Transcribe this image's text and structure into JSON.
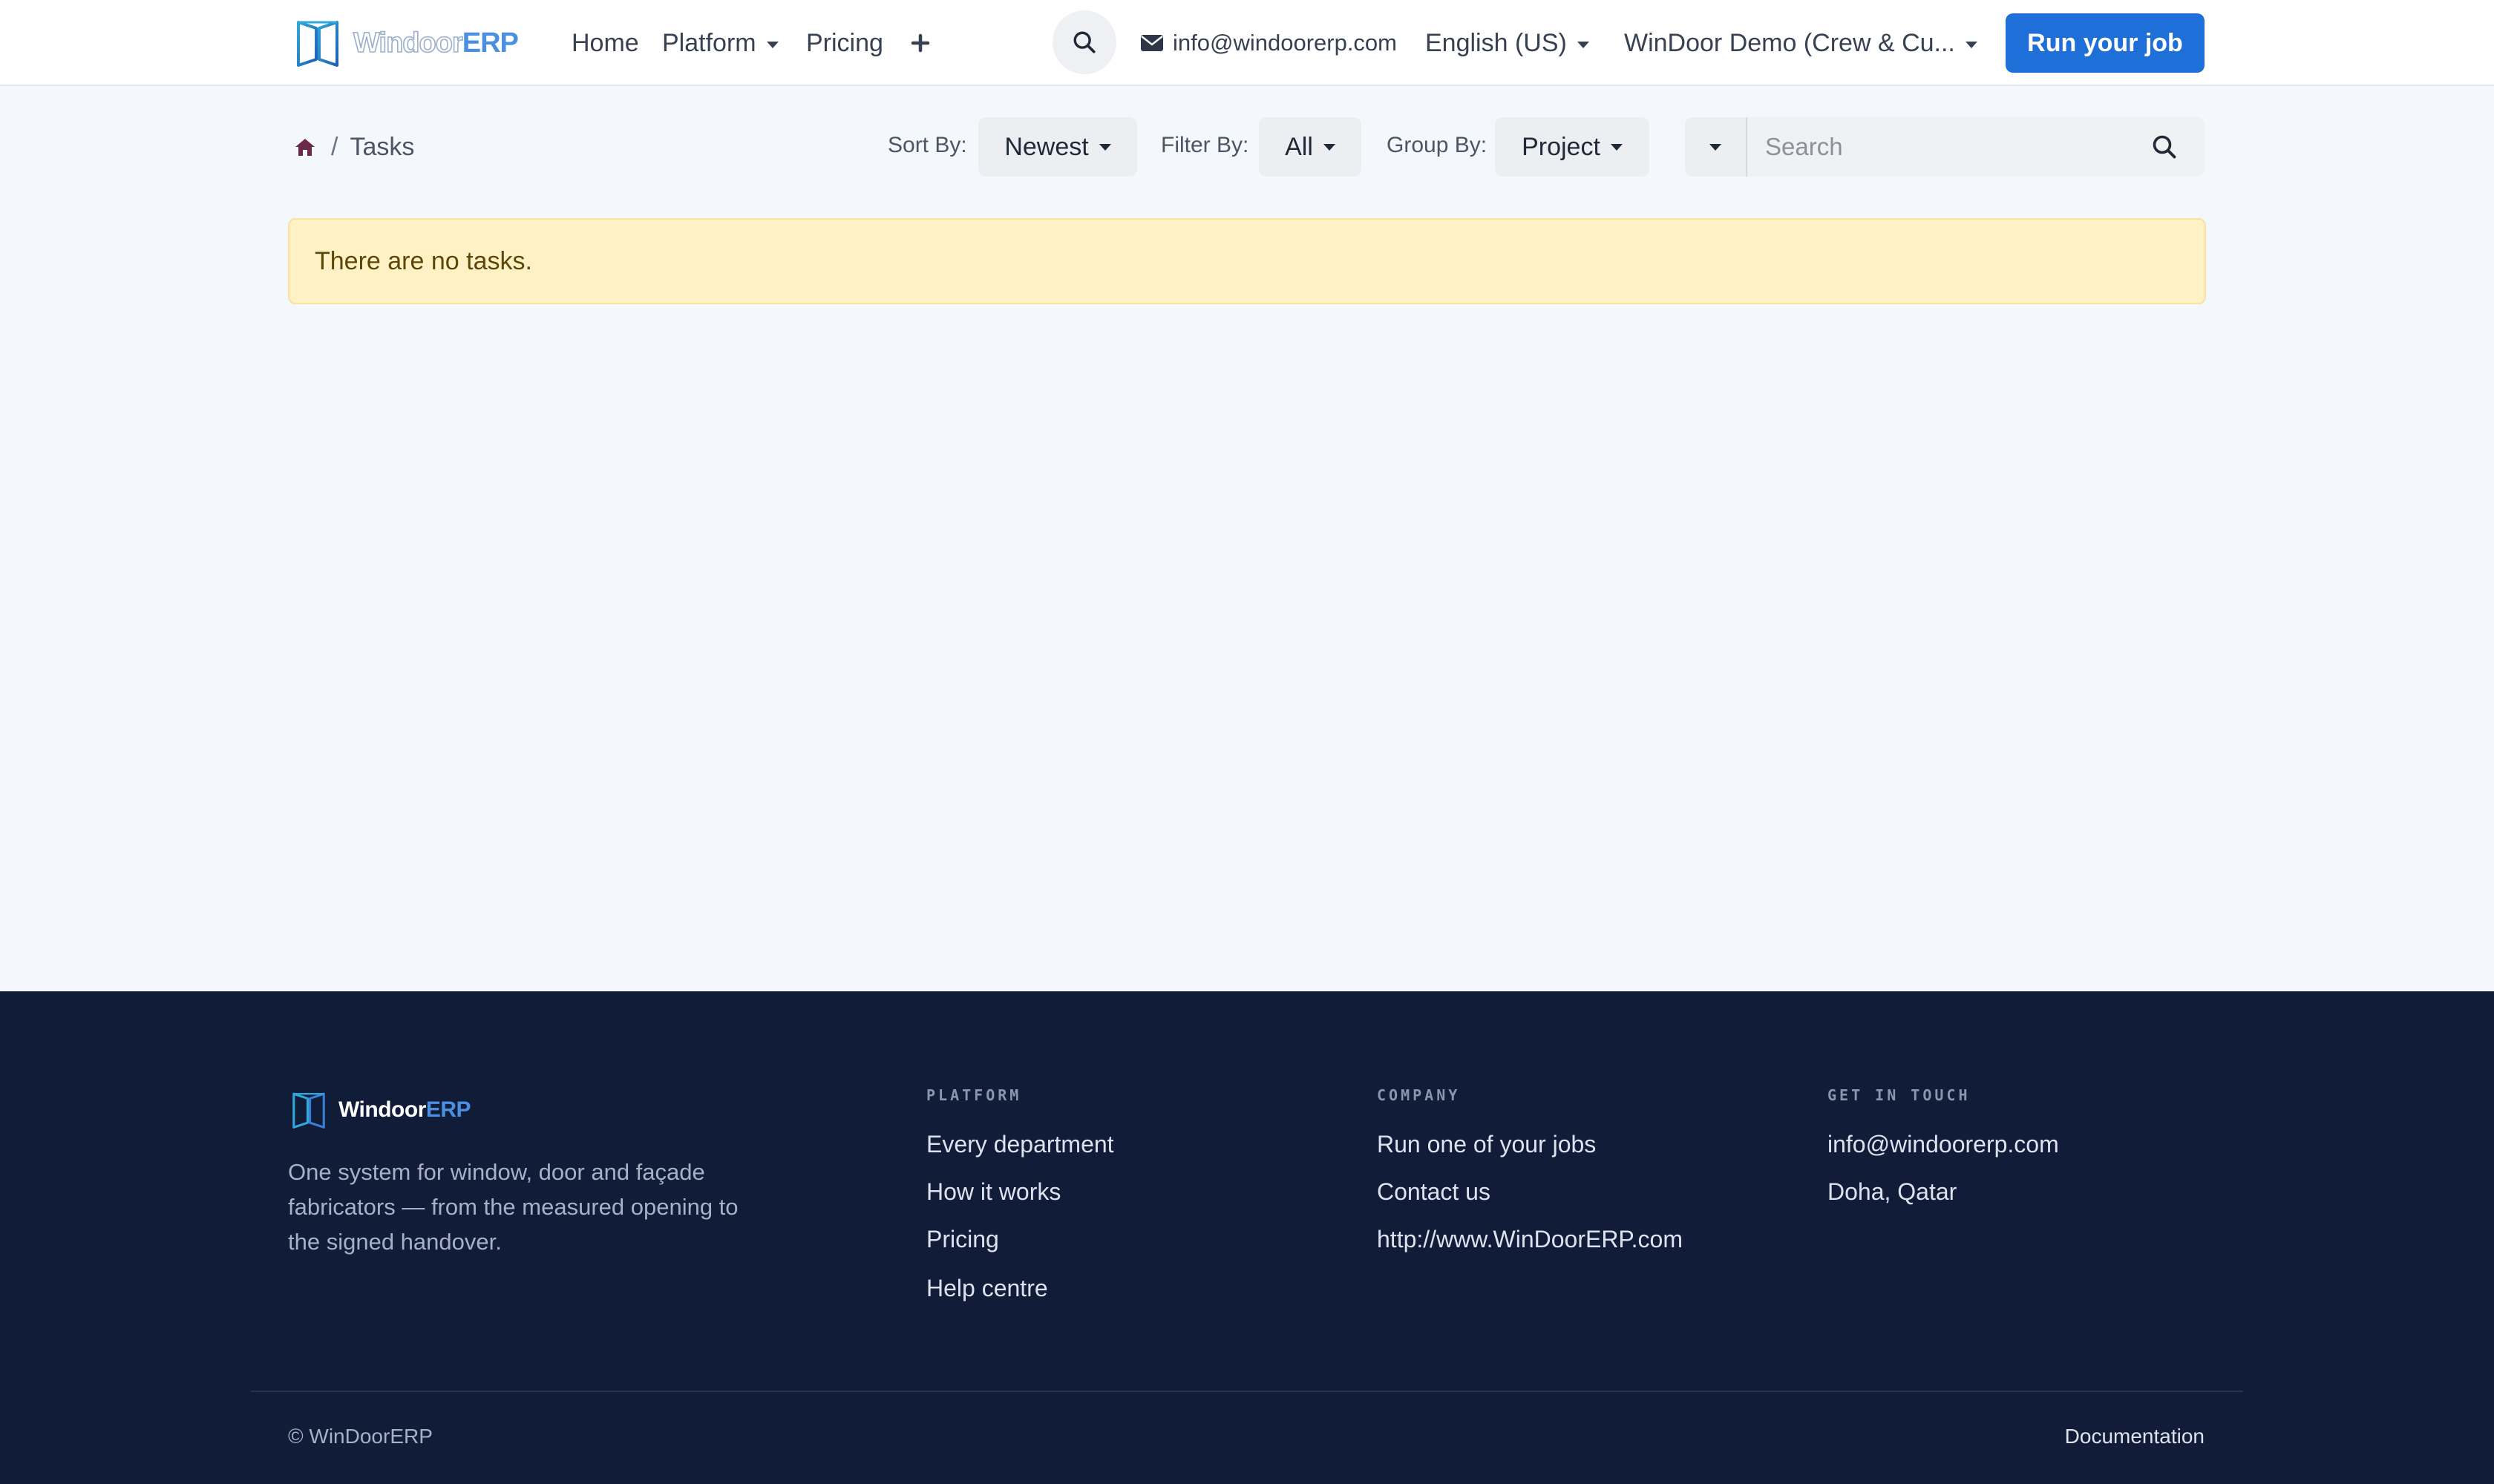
{
  "header": {
    "logo": {
      "part1": "Windoor",
      "part2": "ERP"
    },
    "nav": {
      "home": "Home",
      "platform": "Platform",
      "pricing": "Pricing"
    },
    "email": "info@windoorerp.com",
    "language": "English (US)",
    "company": "WinDoor Demo (Crew & Cu...",
    "cta": "Run your job"
  },
  "toolbar": {
    "breadcrumb_current": "Tasks",
    "breadcrumb_separator": "/",
    "sort_label": "Sort By:",
    "sort_value": "Newest",
    "filter_label": "Filter By:",
    "filter_value": "All",
    "group_label": "Group By:",
    "group_value": "Project",
    "search_placeholder": "Search"
  },
  "alert": {
    "message": "There are no tasks."
  },
  "footer": {
    "logo": {
      "part1": "Windoor",
      "part2": "ERP"
    },
    "description": "One system for window, door and façade fabricators — from the measured opening to the signed handover.",
    "columns": [
      {
        "heading": "PLATFORM",
        "links": [
          "Every department",
          "How it works",
          "Pricing",
          "Help centre"
        ]
      },
      {
        "heading": "COMPANY",
        "links": [
          "Run one of your jobs",
          "Contact us",
          "http://www.WinDoorERP.com"
        ]
      },
      {
        "heading": "GET IN TOUCH",
        "links": [
          "info@windoorerp.com",
          "Doha, Qatar"
        ]
      }
    ],
    "copyright": "© WinDoorERP",
    "documentation": "Documentation"
  },
  "colors": {
    "accent": "#1f6fd8",
    "footer_bg": "#101c38",
    "alert_bg": "#fff1c6",
    "page_bg": "#f4f7fb"
  },
  "icons": [
    "logo-icon",
    "plus-icon",
    "search-icon",
    "envelope-icon",
    "home-icon",
    "caret-down-icon"
  ]
}
